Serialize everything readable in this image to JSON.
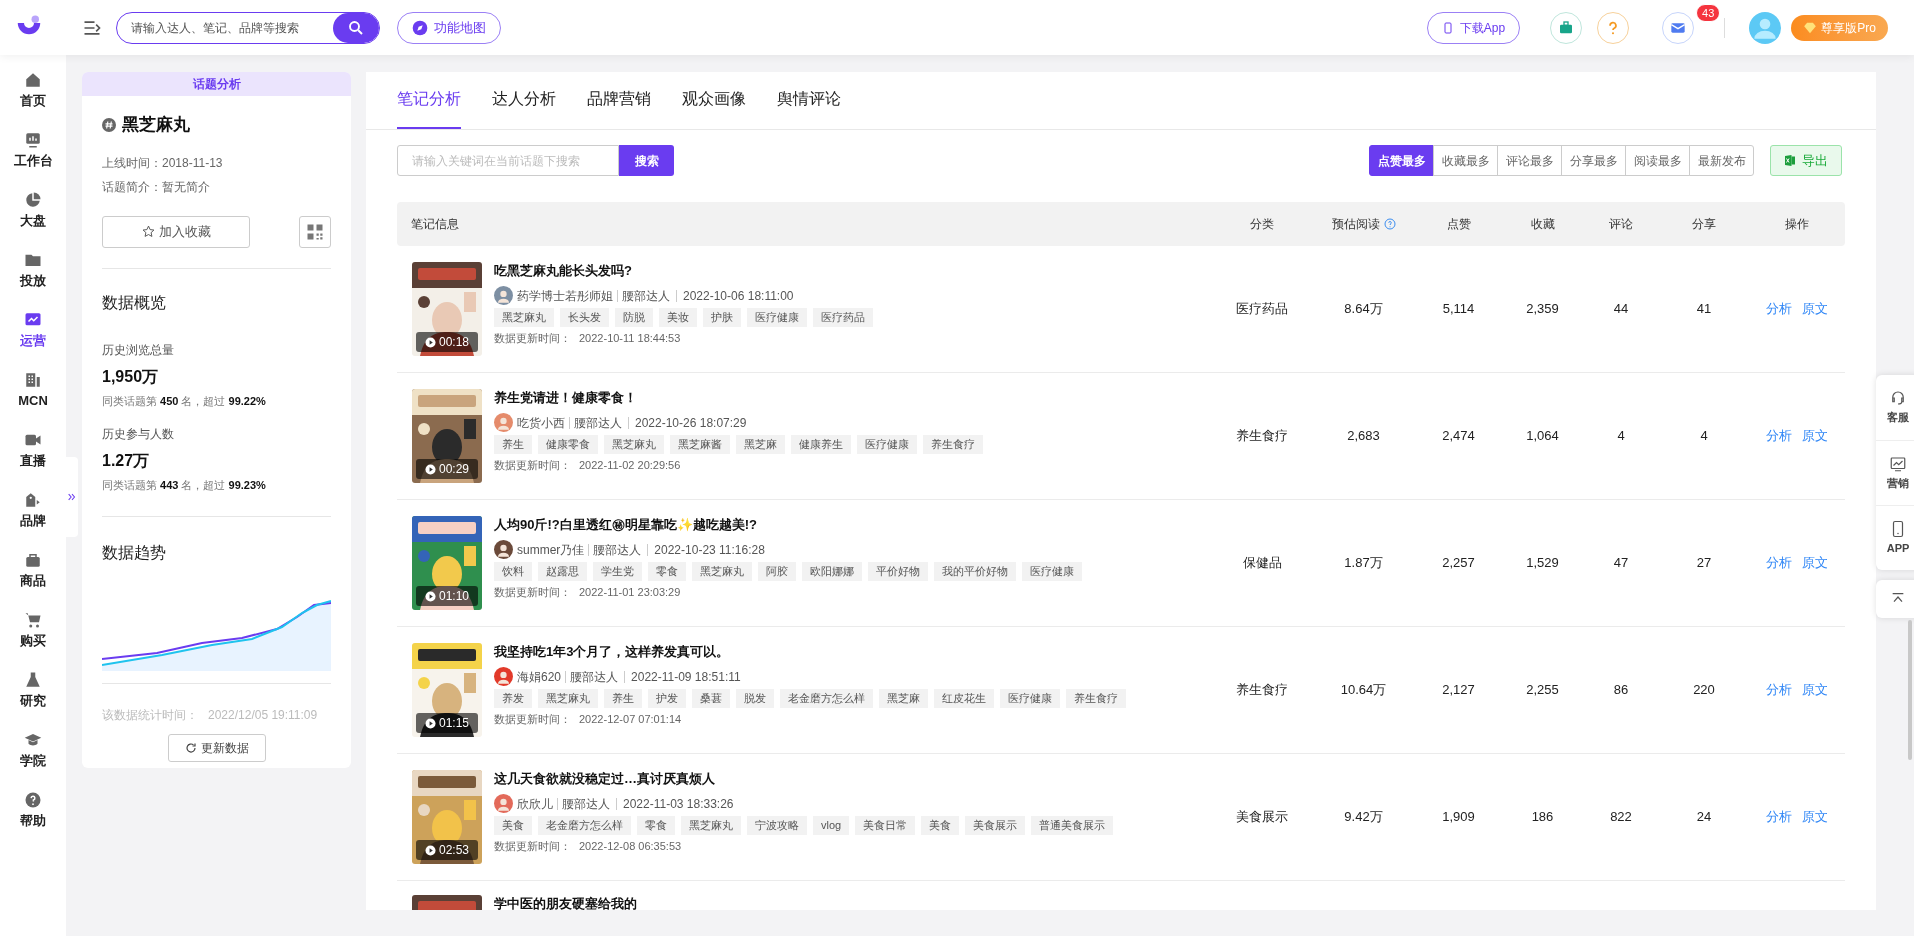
{
  "topbar": {
    "search": {
      "placeholder": "请输入达人、笔记、品牌等搜索"
    },
    "feature_map": "功能地图",
    "download_app": "下载App",
    "mail_badge": "43",
    "plan": "尊享版Pro"
  },
  "nav": [
    {
      "label": "首页",
      "selected": false
    },
    {
      "label": "工作台",
      "selected": false
    },
    {
      "label": "大盘",
      "selected": false
    },
    {
      "label": "投放",
      "selected": false
    },
    {
      "label": "运营",
      "selected": true
    },
    {
      "label": "MCN",
      "selected": false
    },
    {
      "label": "直播",
      "selected": false
    },
    {
      "label": "品牌",
      "selected": false
    },
    {
      "label": "商品",
      "selected": false
    },
    {
      "label": "购买",
      "selected": false
    },
    {
      "label": "研究",
      "selected": false
    },
    {
      "label": "学院",
      "selected": false
    },
    {
      "label": "帮助",
      "selected": false
    }
  ],
  "topic": {
    "banner": "话题分析",
    "name": "黑芝麻丸",
    "info": [
      {
        "label": "上线时间：",
        "value": "2018-11-13"
      },
      {
        "label": "话题简介：",
        "value": "暂无简介"
      }
    ],
    "favorite_button": "加入收藏",
    "overview_title": "数据概览",
    "stats": [
      {
        "label": "历史浏览总量",
        "value": "1,950万",
        "rank": "同类话题第 **450** 名，超过 **99.22%**"
      },
      {
        "label": "历史参与人数",
        "value": "1.27万",
        "rank": "同类话题第 **443** 名，超过 **99.23%**"
      }
    ],
    "trend_title": "数据趋势",
    "stat_time_label": "该数据统计时间：",
    "stat_time": "2022/12/05 19:11:09",
    "refresh_button": "更新数据"
  },
  "tabs": [
    {
      "label": "笔记分析",
      "selected": true
    },
    {
      "label": "达人分析",
      "selected": false
    },
    {
      "label": "品牌营销",
      "selected": false
    },
    {
      "label": "观众画像",
      "selected": false
    },
    {
      "label": "舆情评论",
      "selected": false
    }
  ],
  "keyword_search": {
    "placeholder": "请输入关键词在当前话题下搜索",
    "button": "搜索"
  },
  "sorts": [
    {
      "label": "点赞最多",
      "selected": true
    },
    {
      "label": "收藏最多",
      "selected": false
    },
    {
      "label": "评论最多",
      "selected": false
    },
    {
      "label": "分享最多",
      "selected": false
    },
    {
      "label": "阅读最多",
      "selected": false
    },
    {
      "label": "最新发布",
      "selected": false
    }
  ],
  "export_button": "导出",
  "table": {
    "columns": [
      "笔记信息",
      "分类",
      "预估阅读",
      "点赞",
      "收藏",
      "评论",
      "分享",
      "操作"
    ],
    "rows": [
      {
        "duration": "00:18",
        "title": "吃黑芝麻丸能长头发吗?",
        "author": "药学博士若彤师姐",
        "author_type": "腰部达人",
        "published": "2022-10-06 18:11:00",
        "tags": [
          "黑芝麻丸",
          "长头发",
          "防脱",
          "美妆",
          "护肤",
          "医疗健康",
          "医疗药品"
        ],
        "update_label": "数据更新时间：",
        "updated": "2022-10-11 18:44:53",
        "category": "医疗药品",
        "reads": "8.64万",
        "likes": "5,114",
        "favorites": "2,359",
        "comments": "44",
        "shares": "41",
        "actions": [
          "分析",
          "原文"
        ]
      },
      {
        "duration": "00:29",
        "title": "养生党请进！健康零食！",
        "author": "吃货小西",
        "author_type": "腰部达人",
        "published": "2022-10-26 18:07:29",
        "tags": [
          "养生",
          "健康零食",
          "黑芝麻丸",
          "黑芝麻酱",
          "黑芝麻",
          "健康养生",
          "医疗健康",
          "养生食疗"
        ],
        "update_label": "数据更新时间：",
        "updated": "2022-11-02 20:29:56",
        "category": "养生食疗",
        "reads": "2,683",
        "likes": "2,474",
        "favorites": "1,064",
        "comments": "4",
        "shares": "4",
        "actions": [
          "分析",
          "原文"
        ]
      },
      {
        "duration": "01:10",
        "title": "人均90斤!?白里透红㊙明星靠吃✨越吃越美!?",
        "author": "summer乃佳",
        "author_type": "腰部达人",
        "published": "2022-10-23 11:16:28",
        "tags": [
          "饮料",
          "赵露思",
          "学生党",
          "零食",
          "黑芝麻丸",
          "阿胶",
          "欧阳娜娜",
          "平价好物",
          "我的平价好物",
          "医疗健康"
        ],
        "update_label": "数据更新时间：",
        "updated": "2022-11-01 23:03:29",
        "category": "保健品",
        "reads": "1.87万",
        "likes": "2,257",
        "favorites": "1,529",
        "comments": "47",
        "shares": "27",
        "actions": [
          "分析",
          "原文"
        ]
      },
      {
        "duration": "01:15",
        "title": "我坚持吃1年3个月了，这样养发真可以。",
        "author": "海娟620",
        "author_type": "腰部达人",
        "published": "2022-11-09 18:51:11",
        "tags": [
          "养发",
          "黑芝麻丸",
          "养生",
          "护发",
          "桑葚",
          "脱发",
          "老金磨方怎么样",
          "黑芝麻",
          "红皮花生",
          "医疗健康",
          "养生食疗"
        ],
        "update_label": "数据更新时间：",
        "updated": "2022-12-07 07:01:14",
        "category": "养生食疗",
        "reads": "10.64万",
        "likes": "2,127",
        "favorites": "2,255",
        "comments": "86",
        "shares": "220",
        "actions": [
          "分析",
          "原文"
        ]
      },
      {
        "duration": "02:53",
        "title": "这几天食欲就没稳定过…真讨厌真烦人",
        "author": "欣欣儿",
        "author_type": "腰部达人",
        "published": "2022-11-03 18:33:26",
        "tags": [
          "美食",
          "老金磨方怎么样",
          "零食",
          "黑芝麻丸",
          "宁波攻略",
          "vlog",
          "美食日常",
          "美食",
          "美食展示",
          "普通美食展示"
        ],
        "update_label": "数据更新时间：",
        "updated": "2022-12-08 06:35:53",
        "category": "美食展示",
        "reads": "9.42万",
        "likes": "1,909",
        "favorites": "186",
        "comments": "822",
        "shares": "24",
        "actions": [
          "分析",
          "原文"
        ]
      }
    ],
    "partial_row": {
      "title": "学中医的朋友硬塞给我的"
    }
  },
  "float_tools": [
    "客服",
    "营销",
    "APP"
  ]
}
